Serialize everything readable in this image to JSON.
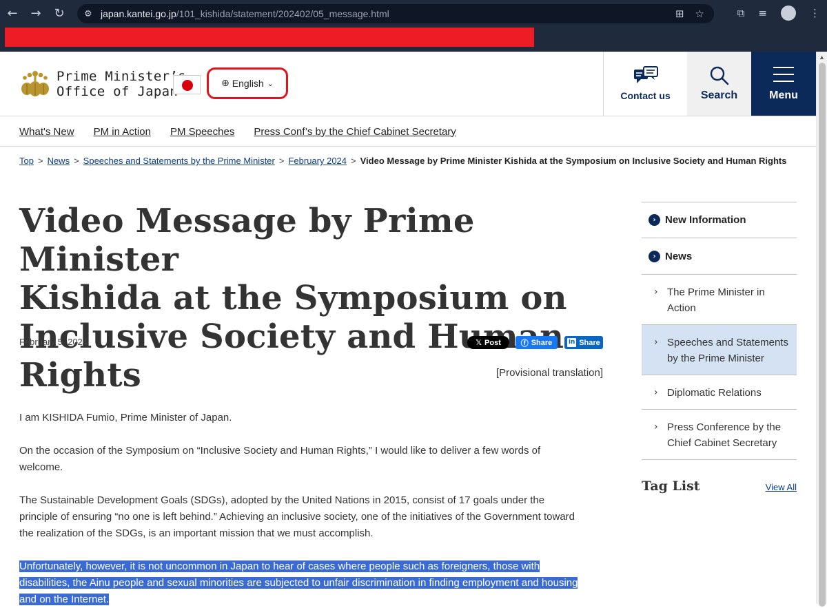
{
  "browser": {
    "url_host": "japan.kantei.go.jp",
    "url_path": "/101_kishida/statement/202402/05_message.html"
  },
  "header": {
    "logo_line1": "Prime Minister’s",
    "logo_line2": "Office of Japan",
    "language": "English",
    "contact_label": "Contact us",
    "search_label": "Search",
    "menu_label": "Menu"
  },
  "subnav": [
    "What's New",
    "PM in Action",
    "PM Speeches",
    "Press Conf’s by the Chief Cabinet Secretary"
  ],
  "breadcrumb": {
    "items": [
      "Top",
      "News",
      "Speeches and Statements by the Prime Minister",
      "February 2024"
    ],
    "current": "Video Message by Prime Minister Kishida at the Symposium on Inclusive Society and Human Rights"
  },
  "article": {
    "title_line1": "Video Message by Prime Minister",
    "title_line2": "Kishida at the Symposium on",
    "title_line3": "Inclusive Society and Human Rights",
    "date": "February 5, 2024",
    "share_x": "Post",
    "share_fb": "Share",
    "share_li": "Share",
    "provisional": "[Provisional translation]",
    "paragraphs": [
      "I am KISHIDA Fumio, Prime Minister of Japan.",
      "On the occasion of the Symposium on “Inclusive Society and Human Rights,” I would like to deliver a few words of welcome.",
      "The Sustainable Development Goals (SDGs), adopted by the United Nations in 2015, consist of 17 goals under the principle of ensuring “no one is left behind.” Achieving an inclusive society, one of the initiatives of the Government toward the realization of the SDGs, is an important mission that we must accomplish.",
      "Unfortunately, however, it is not uncommon in Japan to hear of cases where people such as foreigners, those with disabilities, the Ainu people and sexual minorities are subjected to unfair discrimination in finding employment and housing and on the Internet."
    ]
  },
  "sidebar": {
    "top_items": [
      "New Information",
      "News"
    ],
    "sub_items": [
      "The Prime Minister in Action",
      "Speeches and Statements by the Prime Minister",
      "Diplomatic Relations",
      "Press Conference by the Chief Cabinet Secretary"
    ],
    "tag_list": "Tag List",
    "view_all": "View All"
  }
}
